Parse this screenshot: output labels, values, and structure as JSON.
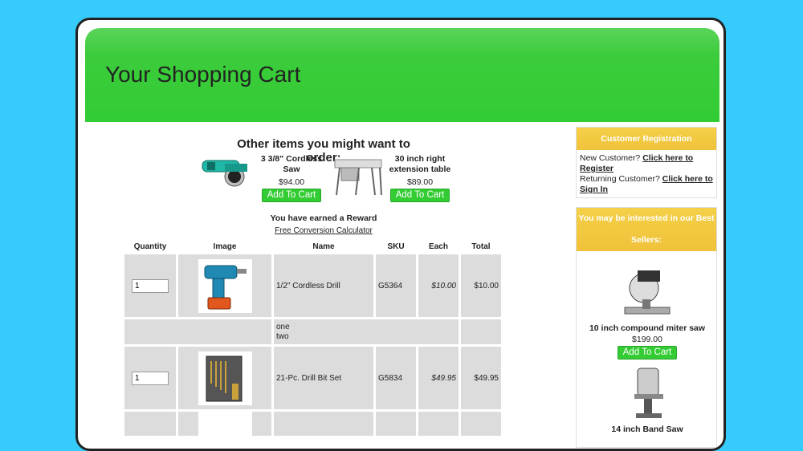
{
  "page": {
    "title": "Your Shopping Cart"
  },
  "suggestions": {
    "heading": "Other items you might want to order:",
    "items": [
      {
        "name": "3 3/8\" Cordless Saw",
        "price": "$94.00",
        "button": "Add To Cart",
        "icon": "cordless-saw-icon"
      },
      {
        "name": "30 inch right extension table",
        "price": "$89.00",
        "button": "Add To Cart",
        "icon": "table-saw-icon"
      }
    ]
  },
  "reward": {
    "text": "You have earned a Reward",
    "link": "Free Conversion Calculator"
  },
  "cart": {
    "headers": [
      "Quantity",
      "Image",
      "Name",
      "SKU",
      "Each",
      "Total"
    ],
    "rows": [
      {
        "qty": "1",
        "image": "cordless-drill-icon",
        "name": "1/2\" Cordless Drill",
        "sku": "G5364",
        "each": "$10.00",
        "total": "$10.00"
      },
      {
        "options": [
          "one",
          "two"
        ]
      },
      {
        "qty": "1",
        "image": "drill-bit-set-icon",
        "name": "21-Pc. Drill Bit Set",
        "sku": "G5834",
        "each": "$49.95",
        "total": "$49.95"
      }
    ]
  },
  "sidebar": {
    "registration": {
      "title": "Customer Registration",
      "new_customer": "New Customer?",
      "register_link": "Click here to Register",
      "returning": "Returning Customer?",
      "signin_link": "Click here to Sign In"
    },
    "best_sellers": {
      "title_line1": "You may be interested in our Best",
      "title_line2": "Sellers:",
      "items": [
        {
          "name": "10 inch compound miter saw",
          "price": "$199.00",
          "button": "Add To Cart",
          "icon": "miter-saw-icon"
        },
        {
          "name": "14 inch Band Saw",
          "icon": "band-saw-icon"
        }
      ]
    }
  },
  "colors": {
    "background": "#35cbfa",
    "header_green": "#33cc33",
    "button_green": "#33cc33",
    "sidebar_header": "#f0c23a"
  }
}
